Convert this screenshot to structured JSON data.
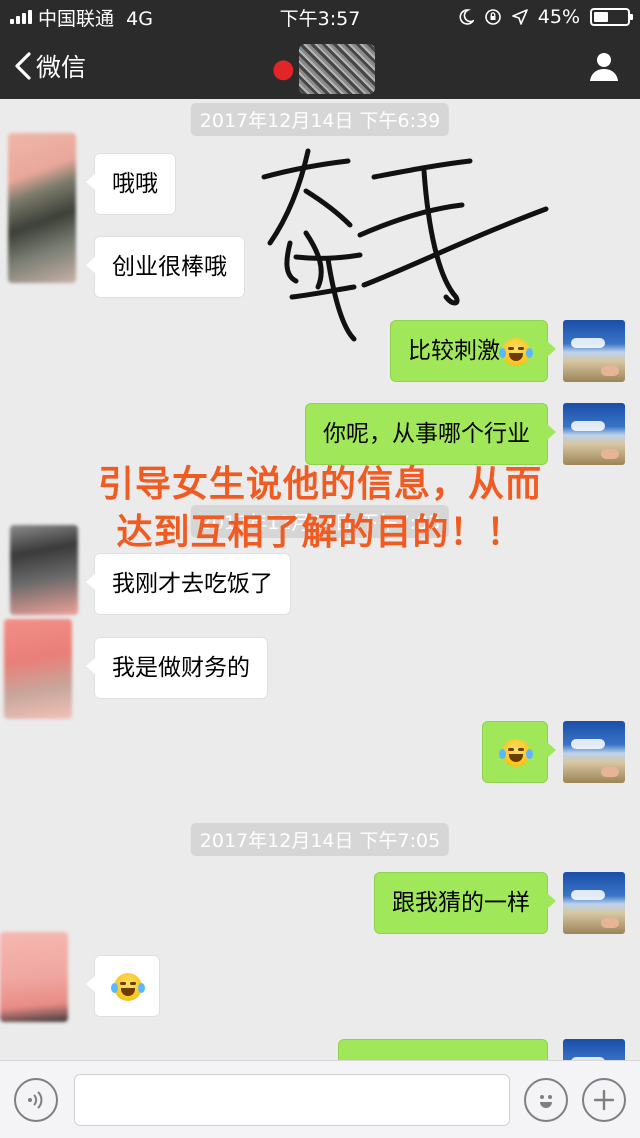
{
  "status_bar": {
    "carrier": "中国联通",
    "network": "4G",
    "time": "下午3:57",
    "battery": "45%",
    "battery_level": 0.45
  },
  "nav": {
    "back_label": "微信"
  },
  "chat": {
    "timestamps": [
      "2017年12月14日 下午6:39",
      "2017年12月14日 下午7:03",
      "2017年12月14日 下午7:05"
    ],
    "messages": [
      {
        "side": "in",
        "text": "哦哦",
        "emoji": ""
      },
      {
        "side": "in",
        "text": "创业很棒哦",
        "emoji": ""
      },
      {
        "side": "out",
        "text": "比较刺激",
        "emoji": "face-with-tears-of-joy"
      },
      {
        "side": "out",
        "text": "你呢，从事哪个行业",
        "emoji": ""
      },
      {
        "side": "in",
        "text": "我刚才去吃饭了",
        "emoji": ""
      },
      {
        "side": "in",
        "text": "我是做财务的",
        "emoji": ""
      },
      {
        "side": "out",
        "text": "",
        "emoji": "face-with-tears-of-joy"
      },
      {
        "side": "out",
        "text": "跟我猜的一样",
        "emoji": ""
      },
      {
        "side": "in",
        "text": "",
        "emoji": "face-with-tears-of-joy"
      }
    ],
    "annotation_lines": [
      "引导女生说他的信息，从而",
      "达到互相了解的目的！！"
    ]
  },
  "colors": {
    "outgoing_bubble": "#a0e75a",
    "incoming_bubble": "#ffffff",
    "nav_background": "#2b2b2b",
    "annotation_text": "#f05b22",
    "handwriting_ink": "#111111"
  },
  "icons": {
    "back": "chevron-left-icon",
    "profile": "person-icon",
    "contact": "strawberry-icon",
    "voice": "voice-icon",
    "sticker": "smiley-icon",
    "more": "plus-icon"
  }
}
